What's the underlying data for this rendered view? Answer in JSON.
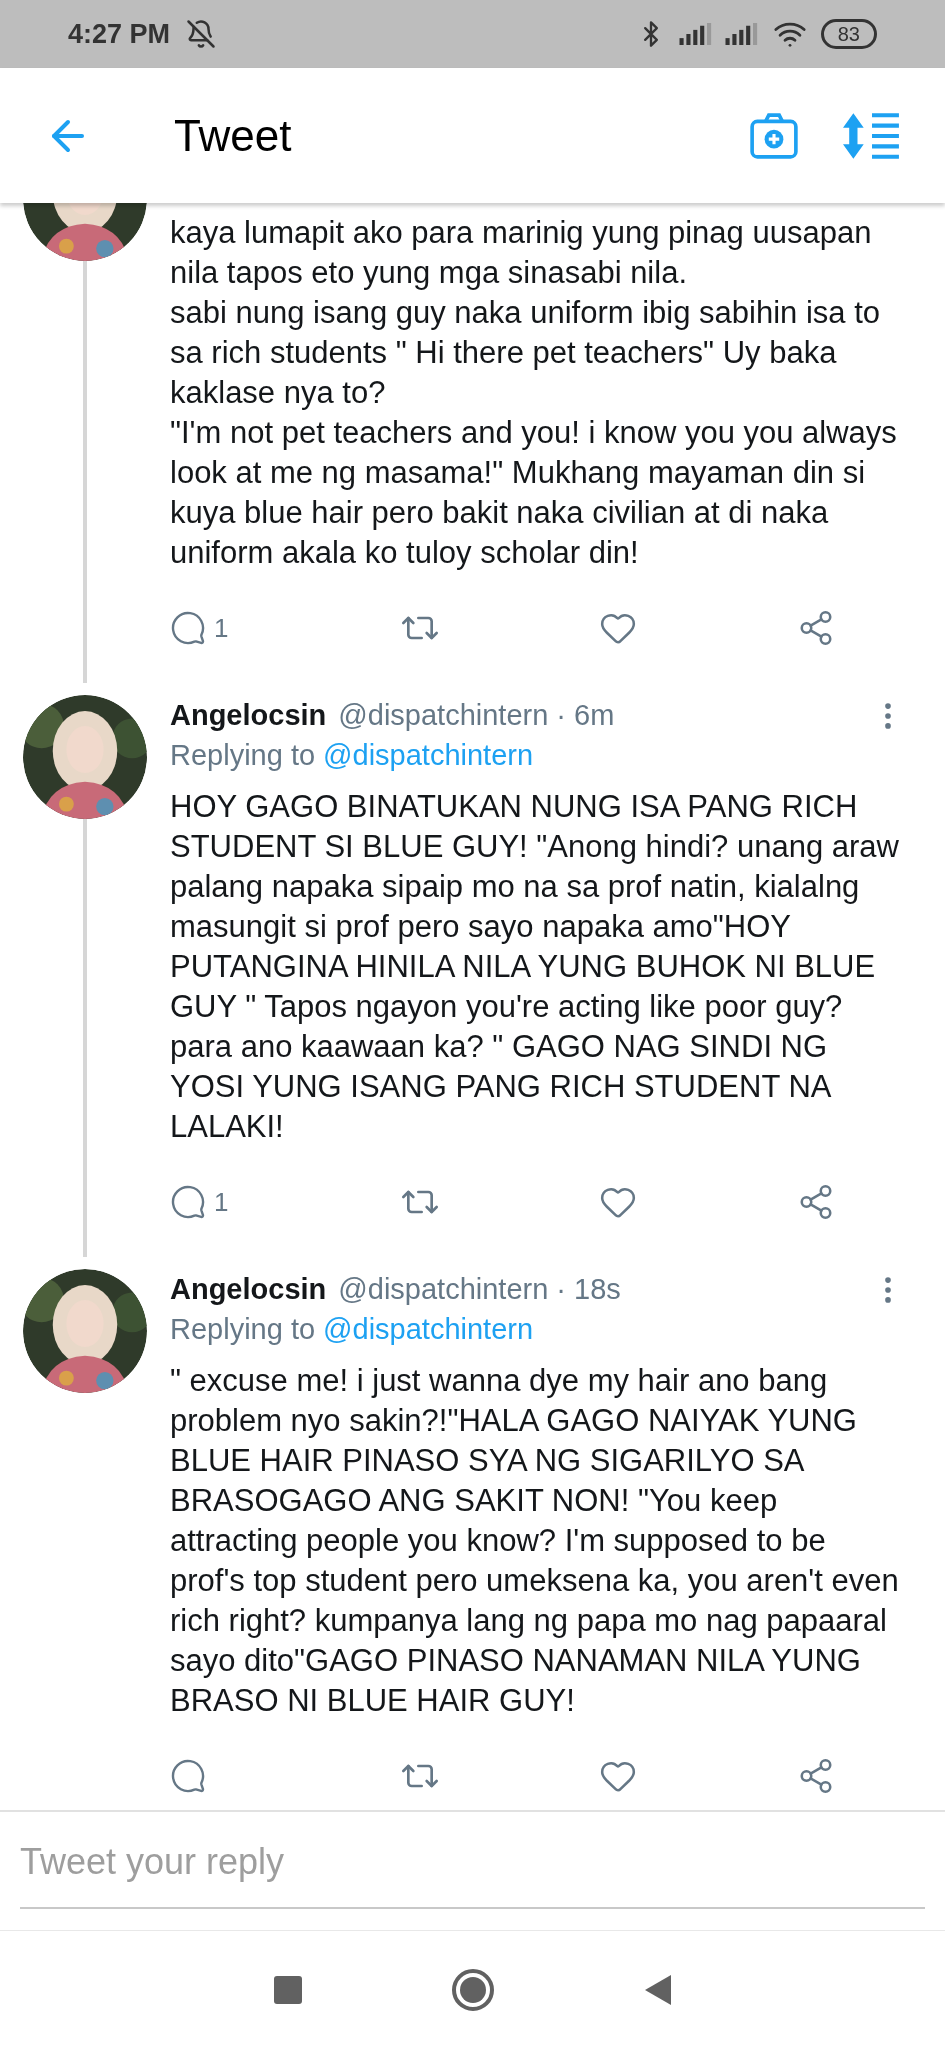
{
  "status_bar": {
    "time": "4:27 PM",
    "battery": "83"
  },
  "header": {
    "title": "Tweet"
  },
  "tweets": [
    {
      "text": "kaya lumapit ako para marinig yung pinag uusapan nila tapos eto yung mga sinasabi nila.\n sabi nung isang guy naka uniform ibig sabihin isa to sa rich students \" Hi there pet teachers\" Uy baka kaklase nya to?\n\"I'm not pet teachers and you! i know you you always look at me ng masama!\" Mukhang mayaman din si kuya blue hair  pero bakit naka civilian at di naka uniform akala ko tuloy scholar din!",
      "reply_count": "1",
      "thread_continues": true
    },
    {
      "name": "Angelocsin",
      "meta": "@dispatchintern · 6m",
      "replying_label": "Replying to",
      "replying_to": "@dispatchintern",
      "text": "HOY GAGO BINATUKAN NUNG ISA PANG RICH STUDENT SI BLUE GUY! \"Anong hindi? unang araw palang napaka sipaip mo na sa prof natin, kialalng masungit si prof pero sayo napaka amo\"HOY PUTANGINA HINILA NILA YUNG BUHOK NI BLUE GUY \" Tapos ngayon you're acting like poor guy? para ano kaawaan ka? \" GAGO NAG SINDI NG YOSI YUNG ISANG PANG RICH STUDENT NA LALAKI!",
      "reply_count": "1",
      "thread_continues": true
    },
    {
      "name": "Angelocsin",
      "meta": "@dispatchintern · 18s",
      "replying_label": "Replying to",
      "replying_to": "@dispatchintern",
      "text": "\" excuse me! i just wanna dye my hair ano bang problem nyo sakin?!\"HALA GAGO NAIYAK YUNG BLUE HAIR PINASO SYA NG SIGARILYO SA BRASOGAGO ANG SAKIT NON! \"You keep attracting people you know? I'm supposed to be prof's top student pero umeksena ka, you aren't even rich right? kumpanya lang ng papa mo nag papaaral sayo dito\"GAGO PINASO NANAMAN NILA YUNG BRASO NI BLUE HAIR GUY!",
      "thread_continues": false
    }
  ],
  "reply": {
    "placeholder": "Tweet your reply"
  }
}
